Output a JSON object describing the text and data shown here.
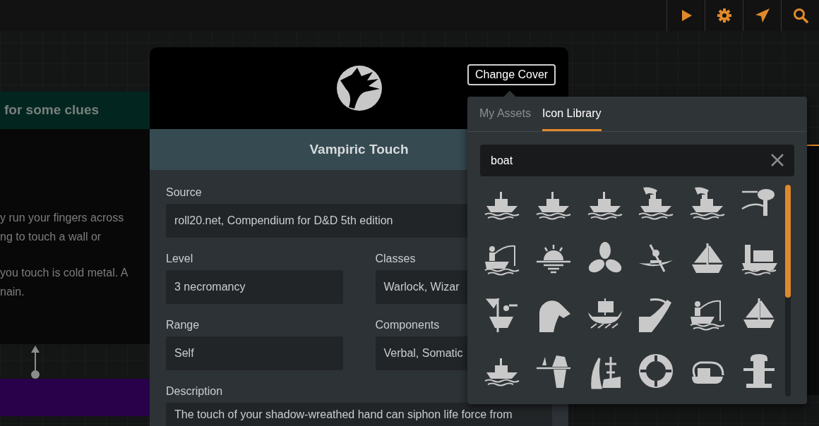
{
  "toolbar": {
    "buttons": [
      {
        "kind": "play"
      },
      {
        "kind": "settings"
      },
      {
        "kind": "send"
      },
      {
        "kind": "search"
      }
    ]
  },
  "background": {
    "heading": "for some clues",
    "paragraphs": [
      [
        "y run your fingers across",
        "ng to touch a wall or"
      ],
      [
        "you touch is cold metal. A",
        "nain."
      ]
    ]
  },
  "card": {
    "change_cover_button": "Change Cover",
    "title": "Vampiric Touch",
    "fields": [
      {
        "label": "Source",
        "value": "roll20.net, Compendium for D&D 5th edition",
        "kind": "wide"
      },
      {
        "label": "Level",
        "value": "3 necromancy",
        "kind": "narrow"
      },
      {
        "label": "Classes",
        "value": "Warlock, Wizar",
        "kind": "narrow"
      },
      {
        "label": "Range",
        "value": "Self",
        "kind": "narrow"
      },
      {
        "label": "Components",
        "value": "Verbal, Somatic",
        "kind": "narrow"
      },
      {
        "label": "Description",
        "value": "The touch of your shadow-wreathed hand can siphon life force from",
        "kind": "wide"
      }
    ]
  },
  "cover_picker": {
    "tabs": [
      {
        "label": "My Assets",
        "selected": false
      },
      {
        "label": "Icon Library",
        "selected": true
      }
    ],
    "search": {
      "value": "boat"
    }
  }
}
